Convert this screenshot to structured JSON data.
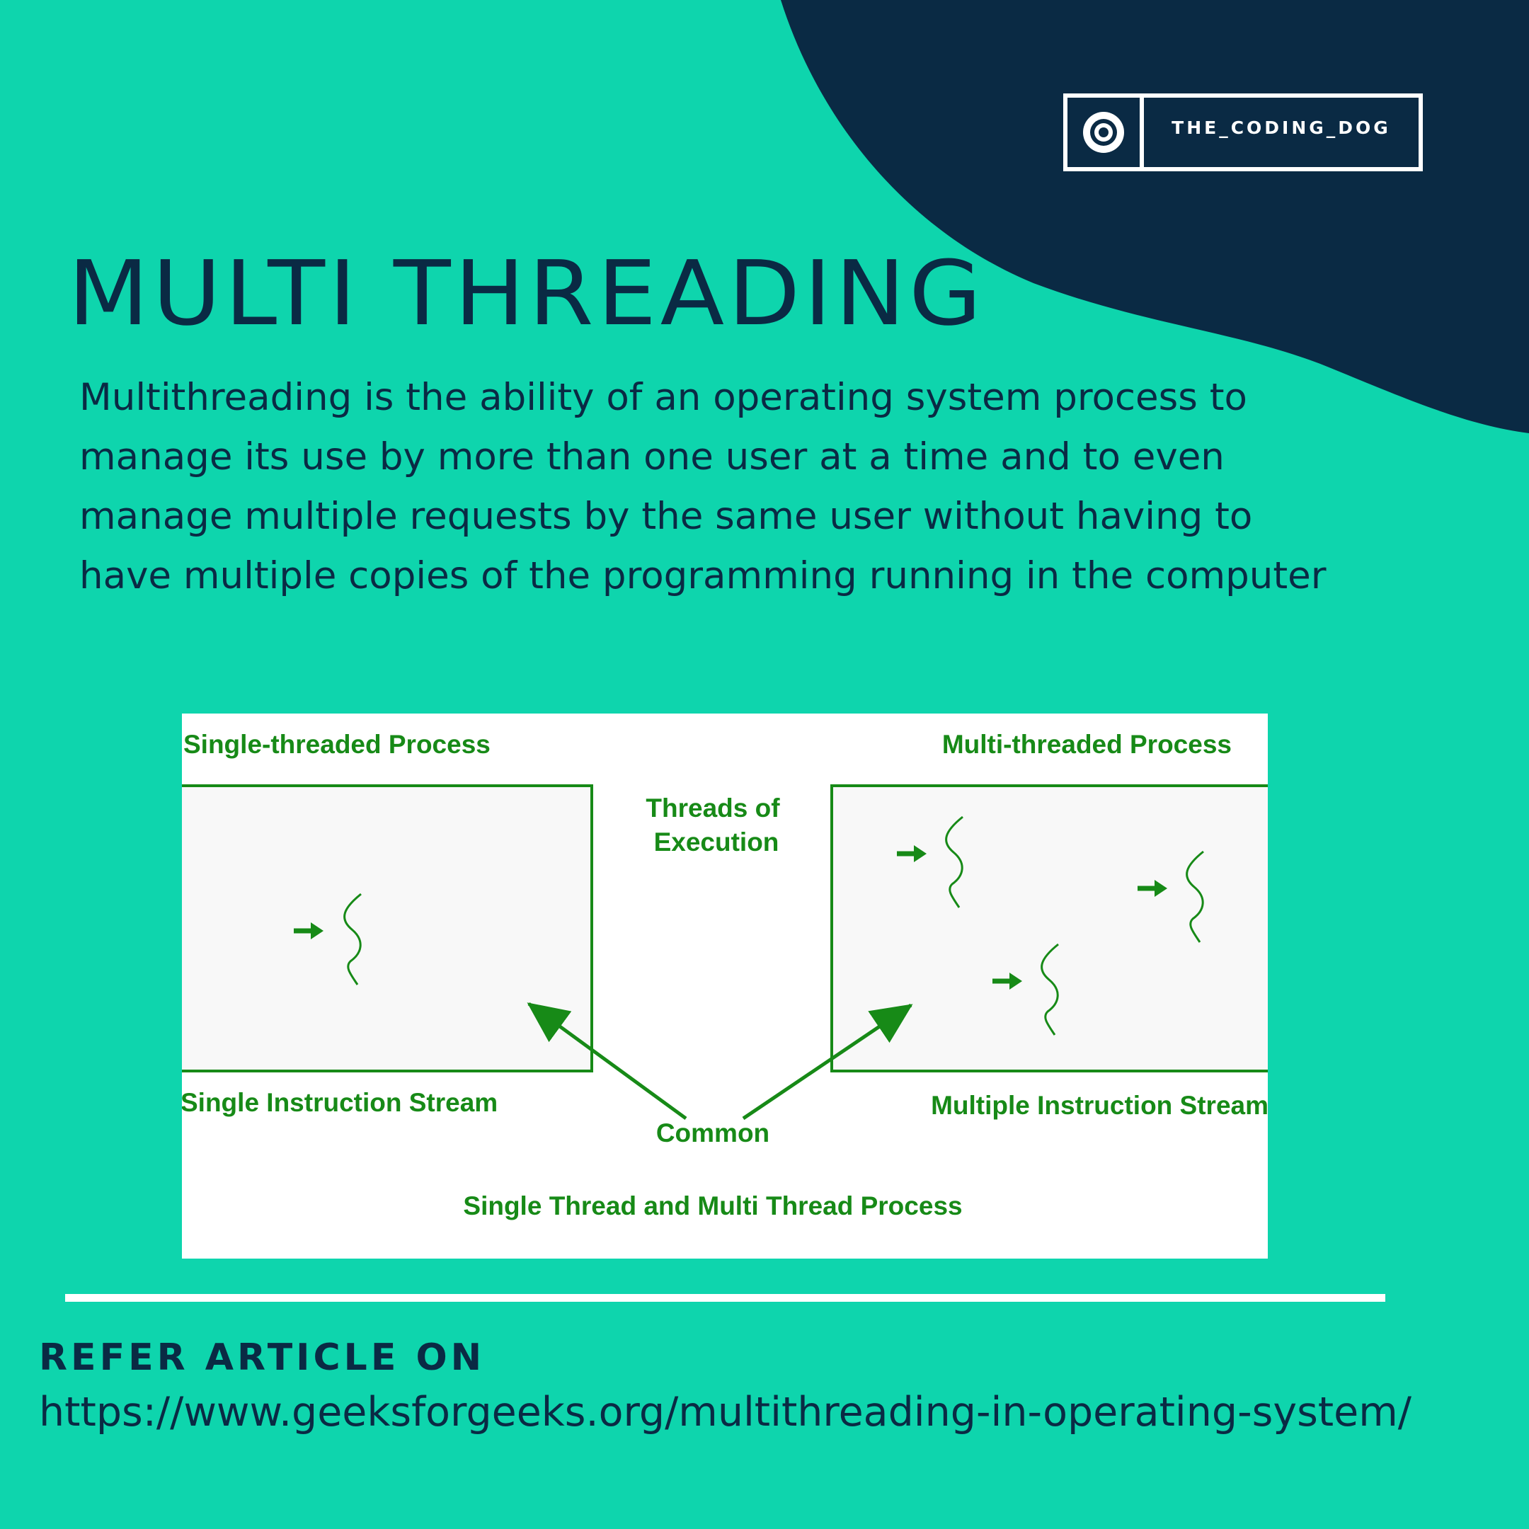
{
  "colors": {
    "background": "#0ed5ad",
    "navy": "#0a2a44",
    "white": "#ffffff",
    "diagram_green": "#178a17"
  },
  "brand": {
    "name": "THE_CODING_DOG",
    "icon": "target-icon"
  },
  "title": "MULTI THREADING",
  "description": {
    "lines": [
      "Multithreading is the ability of an operating system process to",
      "manage its use by more than one user at a time and to even",
      "manage multiple requests by the same user without having to",
      "have multiple copies of the programming running in the computer"
    ]
  },
  "diagram": {
    "single_label": "Single-threaded Process",
    "multi_label": "Multi-threaded Process",
    "threads_label_line1": "Threads of",
    "threads_label_line2": "Execution",
    "single_stream": "Single Instruction Stream",
    "multi_stream": "Multiple Instruction Stream",
    "common": "Common",
    "caption": "Single Thread and Multi Thread Process"
  },
  "refer": {
    "label": "REFER ARTICLE ON",
    "url": "https://www.geeksforgeeks.org/multithreading-in-operating-system/"
  }
}
